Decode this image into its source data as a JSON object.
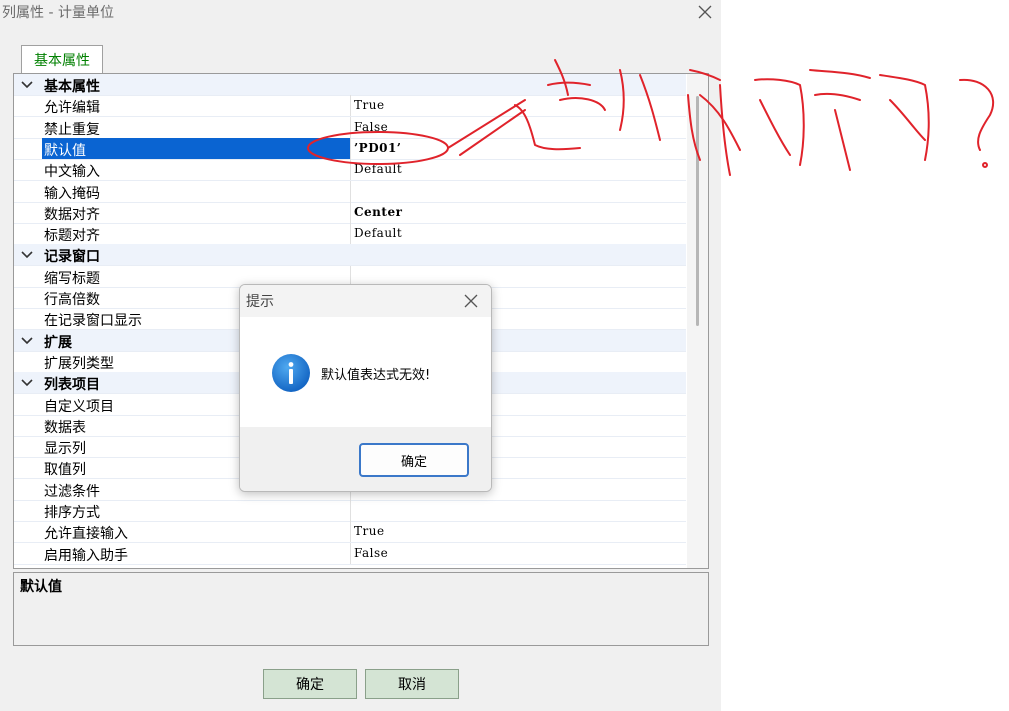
{
  "window": {
    "title": "列属性 - 计量单位"
  },
  "tab": {
    "label": "基本属性"
  },
  "grid": {
    "rows": [
      {
        "type": "category",
        "label": "基本属性"
      },
      {
        "type": "prop",
        "name": "允许编辑",
        "value": "True"
      },
      {
        "type": "prop",
        "name": "禁止重复",
        "value": "False"
      },
      {
        "type": "prop",
        "name": "默认值",
        "value": "’PD01’",
        "selected": true,
        "bold": true
      },
      {
        "type": "prop",
        "name": "中文输入",
        "value": "Default"
      },
      {
        "type": "prop",
        "name": "输入掩码",
        "value": ""
      },
      {
        "type": "prop",
        "name": "数据对齐",
        "value": "Center",
        "bold": true
      },
      {
        "type": "prop",
        "name": "标题对齐",
        "value": "Default"
      },
      {
        "type": "category",
        "label": "记录窗口"
      },
      {
        "type": "prop",
        "name": "缩写标题",
        "value": ""
      },
      {
        "type": "prop",
        "name": "行高倍数",
        "value": ""
      },
      {
        "type": "prop",
        "name": "在记录窗口显示",
        "value": ""
      },
      {
        "type": "category",
        "label": "扩展"
      },
      {
        "type": "prop",
        "name": "扩展列类型",
        "value": ""
      },
      {
        "type": "category",
        "label": "列表项目"
      },
      {
        "type": "prop",
        "name": "自定义项目",
        "value": ""
      },
      {
        "type": "prop",
        "name": "数据表",
        "value": ""
      },
      {
        "type": "prop",
        "name": "显示列",
        "value": ""
      },
      {
        "type": "prop",
        "name": "取值列",
        "value": ""
      },
      {
        "type": "prop",
        "name": "过滤条件",
        "value": ""
      },
      {
        "type": "prop",
        "name": "排序方式",
        "value": ""
      },
      {
        "type": "prop",
        "name": "允许直接输入",
        "value": "True"
      },
      {
        "type": "prop",
        "name": "启用输入助手",
        "value": "False"
      }
    ]
  },
  "description": {
    "title": "默认值"
  },
  "buttons": {
    "ok": "确定",
    "cancel": "取消"
  },
  "message_box": {
    "title": "提示",
    "text": "默认值表达式无效!",
    "ok": "确定",
    "icon": "info-icon"
  },
  "colors": {
    "selection": "#0a64d2",
    "tab_text": "#008000",
    "annotation": "#e0232b",
    "info_icon": "#1e7fd6"
  }
}
